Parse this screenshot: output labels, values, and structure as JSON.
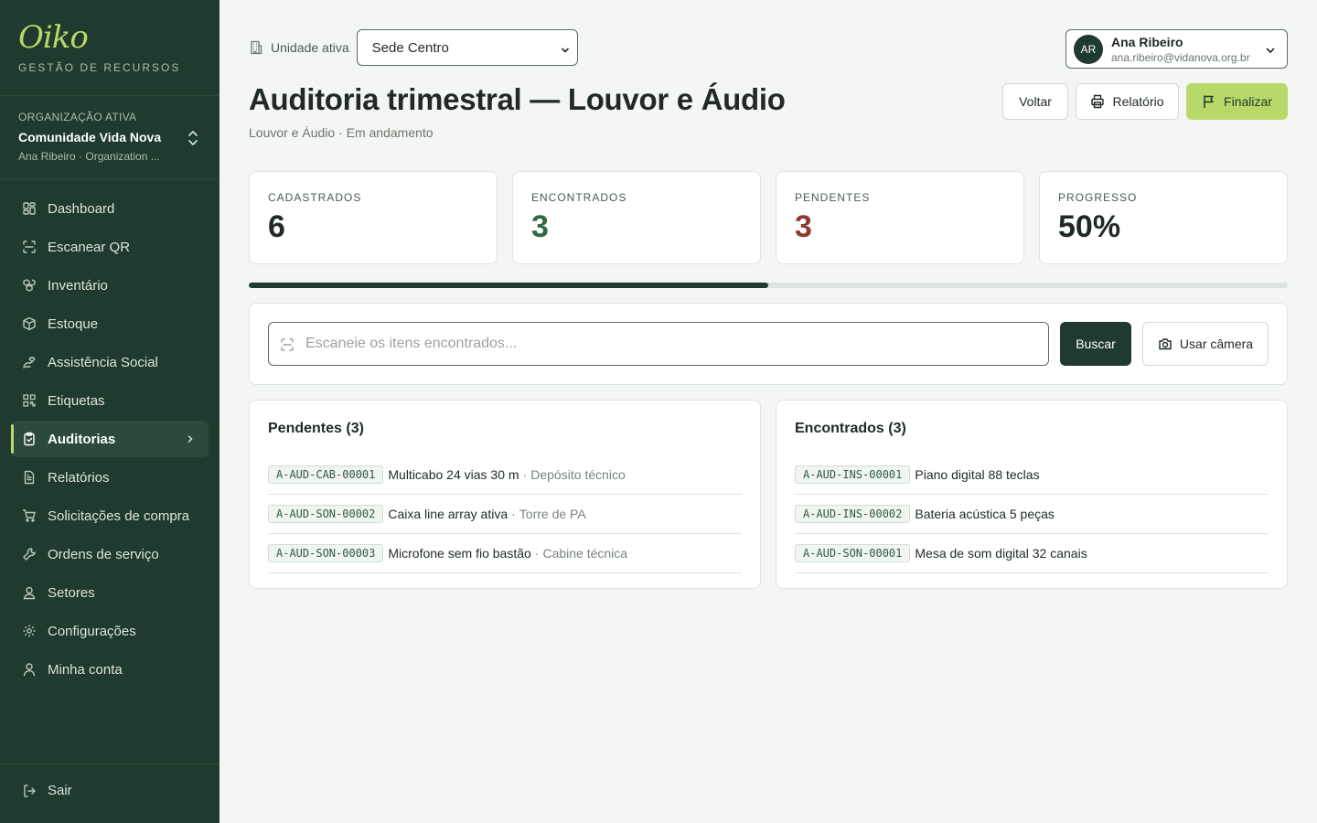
{
  "brand": {
    "logo": "Oiko",
    "subtitle": "GESTÃO DE RECURSOS"
  },
  "org": {
    "caption": "ORGANIZAÇÃO ATIVA",
    "name": "Comunidade Vida Nova",
    "meta": "Ana Ribeiro · Organization ..."
  },
  "nav": [
    {
      "label": "Dashboard",
      "icon": "dashboard-icon"
    },
    {
      "label": "Escanear QR",
      "icon": "scan-icon"
    },
    {
      "label": "Inventário",
      "icon": "boxes-icon"
    },
    {
      "label": "Estoque",
      "icon": "package-icon"
    },
    {
      "label": "Assistência Social",
      "icon": "hand-heart-icon"
    },
    {
      "label": "Etiquetas",
      "icon": "qr-code-icon"
    },
    {
      "label": "Auditorias",
      "icon": "clipboard-check-icon",
      "active": true
    },
    {
      "label": "Relatórios",
      "icon": "file-text-icon"
    },
    {
      "label": "Solicitações de compra",
      "icon": "cart-icon"
    },
    {
      "label": "Ordens de serviço",
      "icon": "wrench-icon"
    },
    {
      "label": "Setores",
      "icon": "users-icon"
    },
    {
      "label": "Configurações",
      "icon": "gear-icon"
    },
    {
      "label": "Minha conta",
      "icon": "user-icon"
    }
  ],
  "logout": {
    "label": "Sair"
  },
  "unit": {
    "label": "Unidade ativa",
    "selected": "Sede Centro"
  },
  "user": {
    "initials": "AR",
    "name": "Ana Ribeiro",
    "email": "ana.ribeiro@vidanova.org.br"
  },
  "page": {
    "title": "Auditoria trimestral — Louvor e Áudio",
    "subtitle": "Louvor e Áudio · Em andamento"
  },
  "actions": {
    "back": "Voltar",
    "report": "Relatório",
    "finish": "Finalizar"
  },
  "stats": [
    {
      "label": "CADASTRADOS",
      "value": "6",
      "tone": "default"
    },
    {
      "label": "ENCONTRADOS",
      "value": "3",
      "tone": "green"
    },
    {
      "label": "PENDENTES",
      "value": "3",
      "tone": "red"
    },
    {
      "label": "PROGRESSO",
      "value": "50%",
      "tone": "default"
    }
  ],
  "progress": {
    "fraction": 0.5
  },
  "scan": {
    "placeholder": "Escaneie os itens encontrados...",
    "search": "Buscar",
    "camera": "Usar câmera"
  },
  "pending": {
    "title": "Pendentes (3)",
    "items": [
      {
        "code": "A-AUD-CAB-00001",
        "name": "Multicabo 24 vias 30 m",
        "location": "Depósito técnico"
      },
      {
        "code": "A-AUD-SON-00002",
        "name": "Caixa line array ativa",
        "location": "Torre de PA"
      },
      {
        "code": "A-AUD-SON-00003",
        "name": "Microfone sem fio bastão",
        "location": "Cabine técnica"
      }
    ]
  },
  "found": {
    "title": "Encontrados (3)",
    "items": [
      {
        "code": "A-AUD-INS-00001",
        "name": "Piano digital 88 teclas"
      },
      {
        "code": "A-AUD-INS-00002",
        "name": "Bateria acústica 5 peças"
      },
      {
        "code": "A-AUD-SON-00001",
        "name": "Mesa de som digital 32 canais"
      }
    ]
  },
  "colors": {
    "sidebar": "#1f3a2e",
    "accent": "#b9d86a",
    "found": "#2f6b3f",
    "pending": "#8e3a2e"
  }
}
